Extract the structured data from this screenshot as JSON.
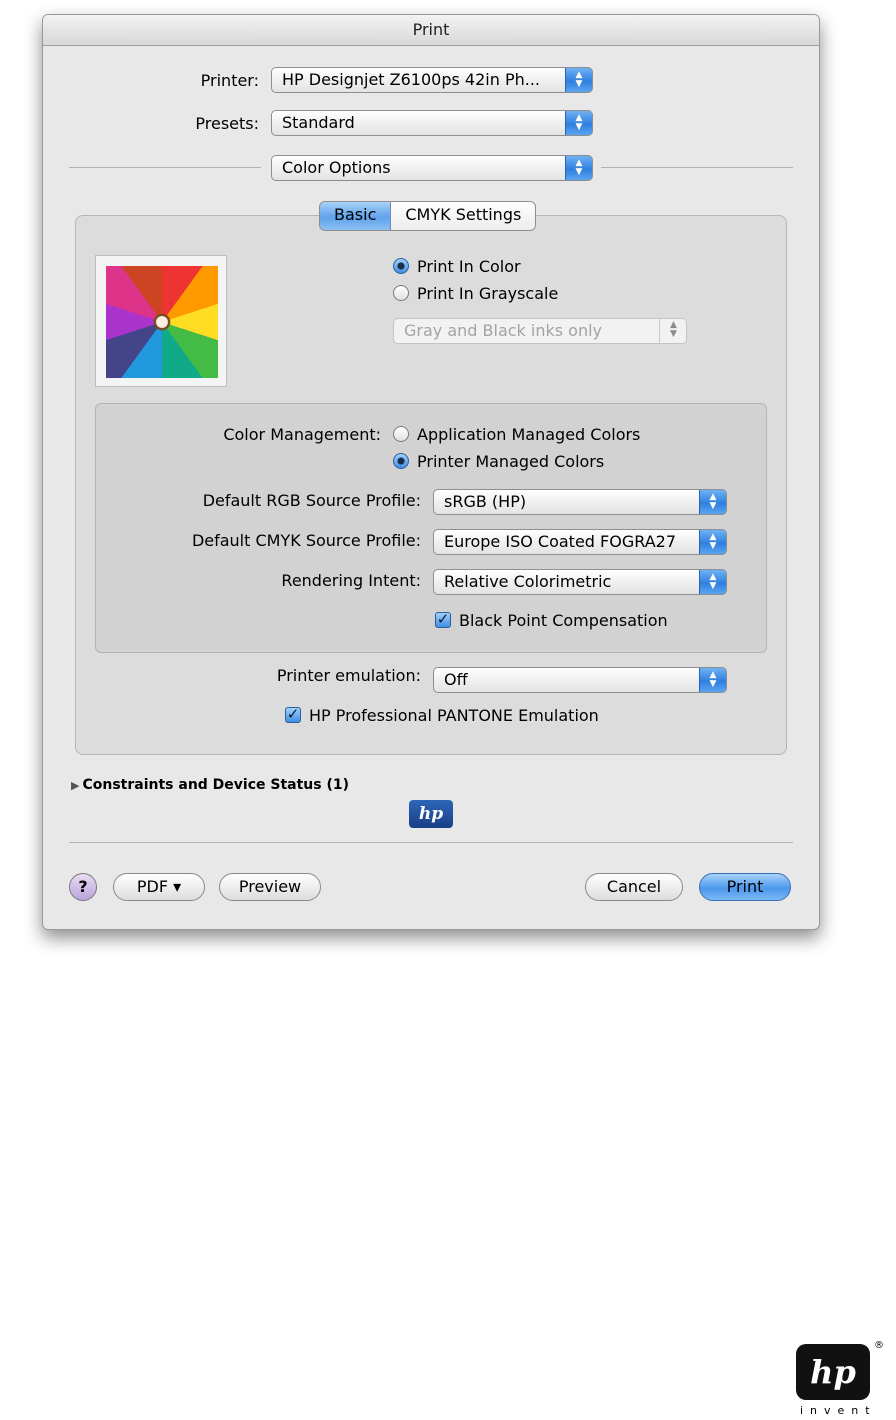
{
  "window": {
    "title": "Print"
  },
  "printer": {
    "label": "Printer:",
    "value": "HP Designjet Z6100ps 42in Ph..."
  },
  "presets": {
    "label": "Presets:",
    "value": "Standard"
  },
  "section": {
    "value": "Color Options"
  },
  "tabs": [
    {
      "label": "Basic",
      "active": true
    },
    {
      "label": "CMYK Settings",
      "active": false
    }
  ],
  "color_mode": {
    "options": [
      {
        "label": "Print In Color",
        "selected": true
      },
      {
        "label": "Print In Grayscale",
        "selected": false
      }
    ],
    "gray_popup": {
      "value": "Gray and Black inks only",
      "enabled": false
    }
  },
  "color_management": {
    "label": "Color Management:",
    "options": [
      {
        "label": "Application Managed Colors",
        "selected": false
      },
      {
        "label": "Printer Managed Colors",
        "selected": true
      }
    ],
    "rgb_profile": {
      "label": "Default RGB Source Profile:",
      "value": "sRGB (HP)"
    },
    "cmyk_profile": {
      "label": "Default CMYK Source Profile:",
      "value": "Europe ISO Coated FOGRA27"
    },
    "rendering_intent": {
      "label": "Rendering Intent:",
      "value": "Relative Colorimetric"
    },
    "black_point": {
      "label": "Black Point Compensation",
      "checked": true
    }
  },
  "emulation": {
    "label": "Printer emulation:",
    "value": "Off"
  },
  "pantone": {
    "label": "HP Professional PANTONE Emulation",
    "checked": true
  },
  "constraints": {
    "label": "Constraints and Device Status (1)"
  },
  "buttons": {
    "help": "?",
    "pdf": "PDF ▾",
    "preview": "Preview",
    "cancel": "Cancel",
    "print": "Print"
  },
  "brand": {
    "mini_logo": "hp",
    "logo": "hp",
    "registered": "®",
    "tagline": "invent"
  },
  "colors": {
    "accent_blue": "#4c97ec",
    "dialog_bg": "#e8e8e8"
  },
  "icons": {
    "popup": "up-down-arrows-icon",
    "disclosure": "disclosure-triangle-icon"
  }
}
